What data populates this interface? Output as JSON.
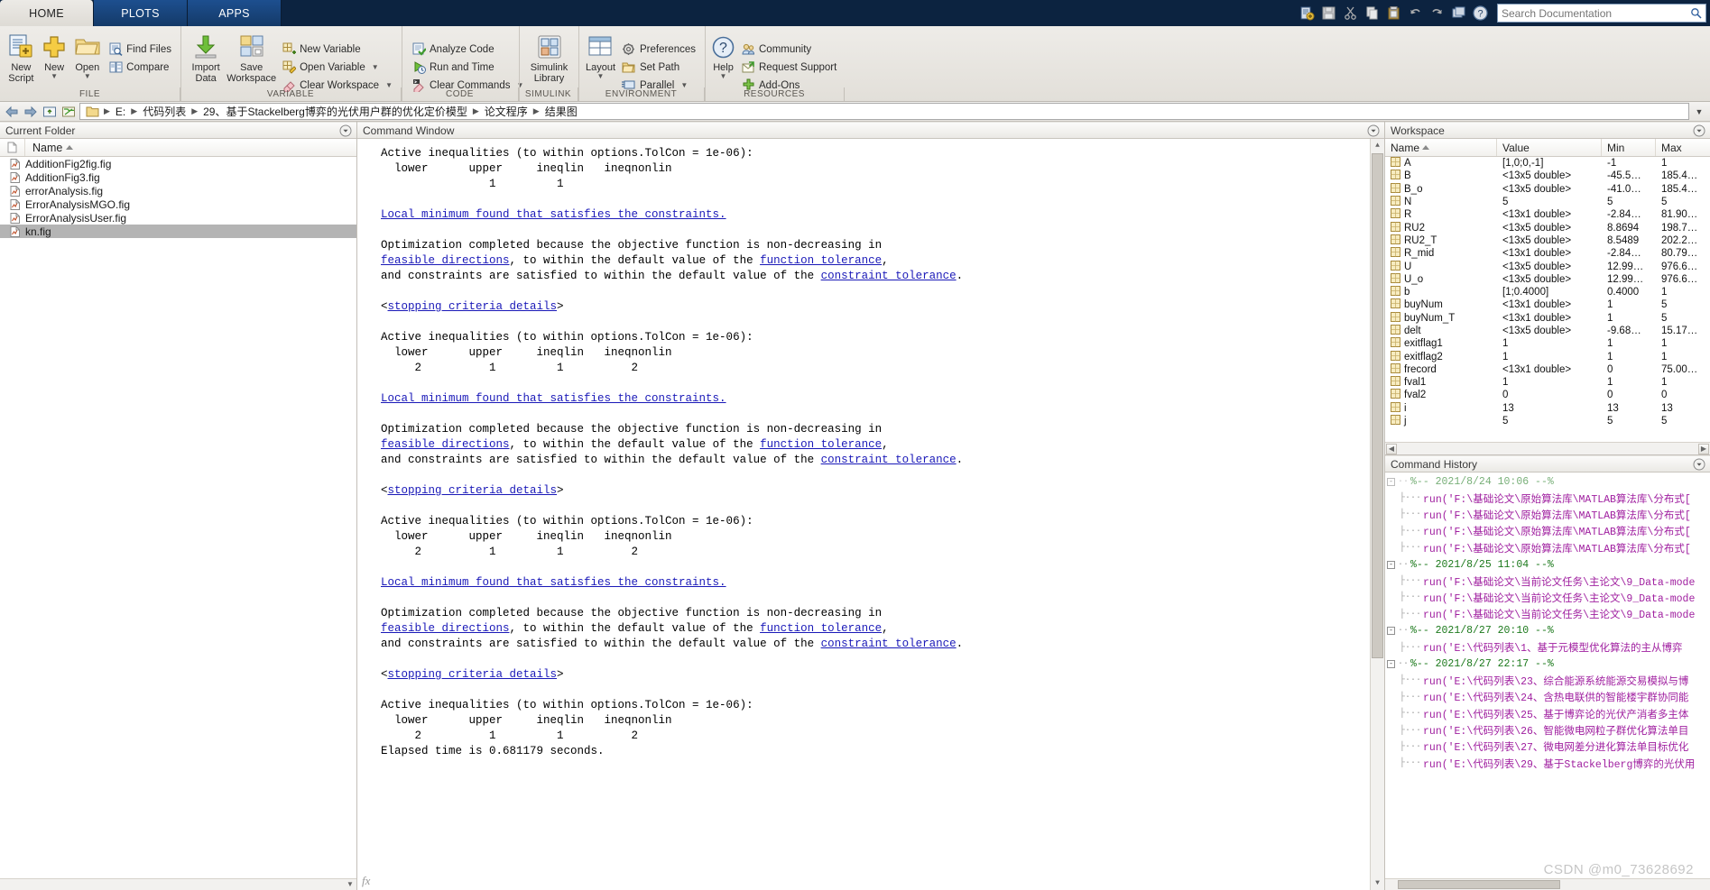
{
  "window": {
    "tabs": [
      {
        "label": "HOME",
        "active": true
      },
      {
        "label": "PLOTS",
        "active": false
      },
      {
        "label": "APPS",
        "active": false
      }
    ]
  },
  "quick_access": {
    "icons": [
      "new-script-icon",
      "save-icon",
      "cut-icon",
      "copy-icon",
      "paste-icon",
      "undo-icon",
      "redo-icon",
      "switch-window-icon",
      "help-icon"
    ],
    "search_placeholder": "Search Documentation",
    "search_value": ""
  },
  "ribbon": {
    "groups": [
      {
        "label": "FILE",
        "big_buttons": [
          {
            "label_line1": "New",
            "label_line2": "Script",
            "icon": "new-script-icon",
            "caret": false
          },
          {
            "label_line1": "New",
            "label_line2": "",
            "icon": "new-plus-icon",
            "caret": true
          },
          {
            "label_line1": "Open",
            "label_line2": "",
            "icon": "open-folder-icon",
            "caret": true
          }
        ],
        "small_buttons": [
          {
            "label": "Find Files",
            "icon": "find-files-icon",
            "caret": false
          },
          {
            "label": "Compare",
            "icon": "compare-icon",
            "caret": false
          }
        ]
      },
      {
        "label": "VARIABLE",
        "big_buttons": [
          {
            "label_line1": "Import",
            "label_line2": "Data",
            "icon": "import-data-icon",
            "caret": false
          },
          {
            "label_line1": "Save",
            "label_line2": "Workspace",
            "icon": "save-workspace-icon",
            "caret": false
          }
        ],
        "small_buttons": [
          {
            "label": "New Variable",
            "icon": "new-variable-icon",
            "caret": false
          },
          {
            "label": "Open Variable",
            "icon": "open-variable-icon",
            "caret": true
          },
          {
            "label": "Clear Workspace",
            "icon": "clear-workspace-icon",
            "caret": true
          }
        ]
      },
      {
        "label": "CODE",
        "big_buttons": [],
        "small_buttons": [
          {
            "label": "Analyze Code",
            "icon": "analyze-code-icon",
            "caret": false
          },
          {
            "label": "Run and Time",
            "icon": "run-and-time-icon",
            "caret": false
          },
          {
            "label": "Clear Commands",
            "icon": "clear-commands-icon",
            "caret": true
          }
        ]
      },
      {
        "label": "SIMULINK",
        "big_buttons": [
          {
            "label_line1": "Simulink",
            "label_line2": "Library",
            "icon": "simulink-library-icon",
            "caret": false
          }
        ],
        "small_buttons": []
      },
      {
        "label": "ENVIRONMENT",
        "big_buttons": [
          {
            "label_line1": "Layout",
            "label_line2": "",
            "icon": "layout-icon",
            "caret": true
          }
        ],
        "small_buttons": [
          {
            "label": "Preferences",
            "icon": "preferences-gear-icon",
            "caret": false
          },
          {
            "label": "Set Path",
            "icon": "set-path-icon",
            "caret": false
          },
          {
            "label": "Parallel",
            "icon": "parallel-icon",
            "caret": true
          }
        ]
      },
      {
        "label": "RESOURCES",
        "big_buttons": [
          {
            "label_line1": "Help",
            "label_line2": "",
            "icon": "help-question-icon",
            "caret": true
          }
        ],
        "small_buttons": [
          {
            "label": "Community",
            "icon": "community-icon",
            "caret": false
          },
          {
            "label": "Request Support",
            "icon": "request-support-icon",
            "caret": false
          },
          {
            "label": "Add-Ons",
            "icon": "add-ons-icon",
            "caret": false
          }
        ]
      }
    ]
  },
  "address_bar": {
    "back_icon": "back-arrow-icon",
    "forward_icon": "forward-arrow-icon",
    "up_icon": "up-folder-icon",
    "browse_icon": "browse-folder-icon",
    "crumbs": [
      "E:",
      "代码列表",
      "29、基于Stackelberg博弈的光伏用户群的优化定价模型",
      "论文程序",
      "结果图"
    ]
  },
  "current_folder": {
    "title": "Current Folder",
    "col_name": "Name",
    "files": [
      {
        "name": "AdditionFig2fig.fig",
        "selected": false
      },
      {
        "name": "AdditionFig3.fig",
        "selected": false
      },
      {
        "name": "errorAnalysis.fig",
        "selected": false
      },
      {
        "name": "ErrorAnalysisMGO.fig",
        "selected": false
      },
      {
        "name": "ErrorAnalysisUser.fig",
        "selected": false
      },
      {
        "name": "kn.fig",
        "selected": true
      }
    ]
  },
  "command_window": {
    "title": "Command Window",
    "lines": [
      [
        {
          "t": "Active inequalities (to within options.TolCon = 1e-06):"
        }
      ],
      [
        {
          "t": "  lower      upper     ineqlin   ineqnonlin"
        }
      ],
      [
        {
          "t": "                1         1"
        }
      ],
      [
        {
          "t": ""
        }
      ],
      [
        {
          "t": "Local minimum found that satisfies the constraints.",
          "link": true
        }
      ],
      [
        {
          "t": ""
        }
      ],
      [
        {
          "t": "Optimization completed because the objective function is non-decreasing in"
        }
      ],
      [
        {
          "t": "feasible directions",
          "link": true
        },
        {
          "t": ", to within the default value of the "
        },
        {
          "t": "function tolerance",
          "link": true
        },
        {
          "t": ","
        }
      ],
      [
        {
          "t": "and constraints are satisfied to within the default value of the "
        },
        {
          "t": "constraint tolerance",
          "link": true
        },
        {
          "t": "."
        }
      ],
      [
        {
          "t": ""
        }
      ],
      [
        {
          "t": "<"
        },
        {
          "t": "stopping criteria details",
          "link": true
        },
        {
          "t": ">"
        }
      ],
      [
        {
          "t": ""
        }
      ],
      [
        {
          "t": "Active inequalities (to within options.TolCon = 1e-06):"
        }
      ],
      [
        {
          "t": "  lower      upper     ineqlin   ineqnonlin"
        }
      ],
      [
        {
          "t": "     2          1         1          2"
        }
      ],
      [
        {
          "t": ""
        }
      ],
      [
        {
          "t": "Local minimum found that satisfies the constraints.",
          "link": true
        }
      ],
      [
        {
          "t": ""
        }
      ],
      [
        {
          "t": "Optimization completed because the objective function is non-decreasing in"
        }
      ],
      [
        {
          "t": "feasible directions",
          "link": true
        },
        {
          "t": ", to within the default value of the "
        },
        {
          "t": "function tolerance",
          "link": true
        },
        {
          "t": ","
        }
      ],
      [
        {
          "t": "and constraints are satisfied to within the default value of the "
        },
        {
          "t": "constraint tolerance",
          "link": true
        },
        {
          "t": "."
        }
      ],
      [
        {
          "t": ""
        }
      ],
      [
        {
          "t": "<"
        },
        {
          "t": "stopping criteria details",
          "link": true
        },
        {
          "t": ">"
        }
      ],
      [
        {
          "t": ""
        }
      ],
      [
        {
          "t": "Active inequalities (to within options.TolCon = 1e-06):"
        }
      ],
      [
        {
          "t": "  lower      upper     ineqlin   ineqnonlin"
        }
      ],
      [
        {
          "t": "     2          1         1          2"
        }
      ],
      [
        {
          "t": ""
        }
      ],
      [
        {
          "t": "Local minimum found that satisfies the constraints.",
          "link": true
        }
      ],
      [
        {
          "t": ""
        }
      ],
      [
        {
          "t": "Optimization completed because the objective function is non-decreasing in"
        }
      ],
      [
        {
          "t": "feasible directions",
          "link": true
        },
        {
          "t": ", to within the default value of the "
        },
        {
          "t": "function tolerance",
          "link": true
        },
        {
          "t": ","
        }
      ],
      [
        {
          "t": "and constraints are satisfied to within the default value of the "
        },
        {
          "t": "constraint tolerance",
          "link": true
        },
        {
          "t": "."
        }
      ],
      [
        {
          "t": ""
        }
      ],
      [
        {
          "t": "<"
        },
        {
          "t": "stopping criteria details",
          "link": true
        },
        {
          "t": ">"
        }
      ],
      [
        {
          "t": ""
        }
      ],
      [
        {
          "t": "Active inequalities (to within options.TolCon = 1e-06):"
        }
      ],
      [
        {
          "t": "  lower      upper     ineqlin   ineqnonlin"
        }
      ],
      [
        {
          "t": "     2          1         1          2"
        }
      ],
      [
        {
          "t": "Elapsed time is 0.681179 seconds."
        }
      ],
      [
        {
          "t": ""
        }
      ]
    ],
    "prompt": "fx"
  },
  "workspace": {
    "title": "Workspace",
    "columns": [
      "Name",
      "Value",
      "Min",
      "Max"
    ],
    "rows": [
      {
        "name": "A",
        "value": "[1,0;0,-1]",
        "min": "-1",
        "max": "1"
      },
      {
        "name": "B",
        "value": "<13x5 double>",
        "min": "-45.5…",
        "max": "185.4…"
      },
      {
        "name": "B_o",
        "value": "<13x5 double>",
        "min": "-41.0…",
        "max": "185.4…"
      },
      {
        "name": "N",
        "value": "5",
        "min": "5",
        "max": "5"
      },
      {
        "name": "R",
        "value": "<13x1 double>",
        "min": "-2.84…",
        "max": "81.90…"
      },
      {
        "name": "RU2",
        "value": "<13x5 double>",
        "min": "8.8694",
        "max": "198.7…"
      },
      {
        "name": "RU2_T",
        "value": "<13x5 double>",
        "min": "8.5489",
        "max": "202.2…"
      },
      {
        "name": "R_mid",
        "value": "<13x1 double>",
        "min": "-2.84…",
        "max": "80.79…"
      },
      {
        "name": "U",
        "value": "<13x5 double>",
        "min": "12.99…",
        "max": "976.6…"
      },
      {
        "name": "U_o",
        "value": "<13x5 double>",
        "min": "12.99…",
        "max": "976.6…"
      },
      {
        "name": "b",
        "value": "[1;0.4000]",
        "min": "0.4000",
        "max": "1"
      },
      {
        "name": "buyNum",
        "value": "<13x1 double>",
        "min": "1",
        "max": "5"
      },
      {
        "name": "buyNum_T",
        "value": "<13x1 double>",
        "min": "1",
        "max": "5"
      },
      {
        "name": "delt",
        "value": "<13x5 double>",
        "min": "-9.68…",
        "max": "15.17…"
      },
      {
        "name": "exitflag1",
        "value": "1",
        "min": "1",
        "max": "1"
      },
      {
        "name": "exitflag2",
        "value": "1",
        "min": "1",
        "max": "1"
      },
      {
        "name": "frecord",
        "value": "<13x1 double>",
        "min": "0",
        "max": "75.00…"
      },
      {
        "name": "fval1",
        "value": "1",
        "min": "1",
        "max": "1"
      },
      {
        "name": "fval2",
        "value": "0",
        "min": "0",
        "max": "0"
      },
      {
        "name": "i",
        "value": "13",
        "min": "13",
        "max": "13"
      },
      {
        "name": "j",
        "value": "5",
        "min": "5",
        "max": "5"
      }
    ]
  },
  "command_history": {
    "title": "Command History",
    "entries": [
      {
        "type": "session",
        "text": "%-- 2021/8/24 10:06 --%",
        "clipped": true
      },
      {
        "type": "cmd",
        "text": "run('F:\\基础论文\\原始算法库\\MATLAB算法库\\分布式["
      },
      {
        "type": "cmd",
        "text": "run('F:\\基础论文\\原始算法库\\MATLAB算法库\\分布式["
      },
      {
        "type": "cmd",
        "text": "run('F:\\基础论文\\原始算法库\\MATLAB算法库\\分布式["
      },
      {
        "type": "cmd",
        "text": "run('F:\\基础论文\\原始算法库\\MATLAB算法库\\分布式["
      },
      {
        "type": "session",
        "text": "%-- 2021/8/25 11:04 --%"
      },
      {
        "type": "cmd",
        "text": "run('F:\\基础论文\\当前论文任务\\主论文\\9_Data-mode"
      },
      {
        "type": "cmd",
        "text": "run('F:\\基础论文\\当前论文任务\\主论文\\9_Data-mode"
      },
      {
        "type": "cmd",
        "text": "run('F:\\基础论文\\当前论文任务\\主论文\\9_Data-mode"
      },
      {
        "type": "session",
        "text": "%-- 2021/8/27 20:10 --%"
      },
      {
        "type": "cmd",
        "text": "run('E:\\代码列表\\1、基于元模型优化算法的主从博弈"
      },
      {
        "type": "session",
        "text": "%-- 2021/8/27 22:17 --%"
      },
      {
        "type": "cmd",
        "text": "run('E:\\代码列表\\23、综合能源系统能源交易模拟与博"
      },
      {
        "type": "cmd",
        "text": "run('E:\\代码列表\\24、含热电联供的智能楼宇群协同能"
      },
      {
        "type": "cmd",
        "text": "run('E:\\代码列表\\25、基于博弈论的光伏产消者多主体"
      },
      {
        "type": "cmd",
        "text": "run('E:\\代码列表\\26、智能微电网粒子群优化算法单目"
      },
      {
        "type": "cmd",
        "text": "run('E:\\代码列表\\27、微电网差分进化算法单目标优化"
      },
      {
        "type": "cmd",
        "text": "run('E:\\代码列表\\29、基于Stackelberg博弈的光伏用"
      }
    ]
  },
  "watermark": "CSDN @m0_73628692",
  "colors": {
    "titlebar": "#0c2340",
    "tab_inactive": "#17437a",
    "ribbon": "#e9e7e3",
    "link": "#1a19b8",
    "selection": "#b4b4b4",
    "session": "#1d7a1d",
    "command": "#a020a0"
  }
}
